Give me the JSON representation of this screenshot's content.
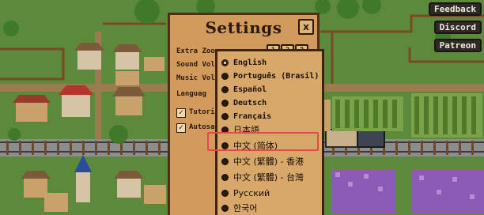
{
  "links": {
    "feedback": "Feedback",
    "discord": "Discord",
    "patreon": "Patreon"
  },
  "settings": {
    "title": "Settings",
    "close": "x",
    "extra_zoom_label": "Extra Zoo",
    "zoom_options": [
      "1",
      "2",
      "3"
    ],
    "sound_label": "Sound Vol",
    "music_label": "Music Vol",
    "language_label": "Languag",
    "tutorial_label": "Tutori",
    "autosave_label": "Autosa",
    "tutorial_checked": true,
    "autosave_checked": true
  },
  "language_menu": {
    "selected_index": 0,
    "highlighted_index": 6,
    "items": [
      "English",
      "Português (Brasil)",
      "Español",
      "Deutsch",
      "Français",
      "日本語",
      "中文 (简体)",
      "中文 (繁體) - 香港",
      "中文 (繁體) - 台灣",
      "Русский",
      "한국어"
    ]
  },
  "colors": {
    "panel": "#d29a5b",
    "panel_border": "#4d2e16",
    "highlight": "#e14b4b",
    "grass": "#5d8a3a"
  }
}
